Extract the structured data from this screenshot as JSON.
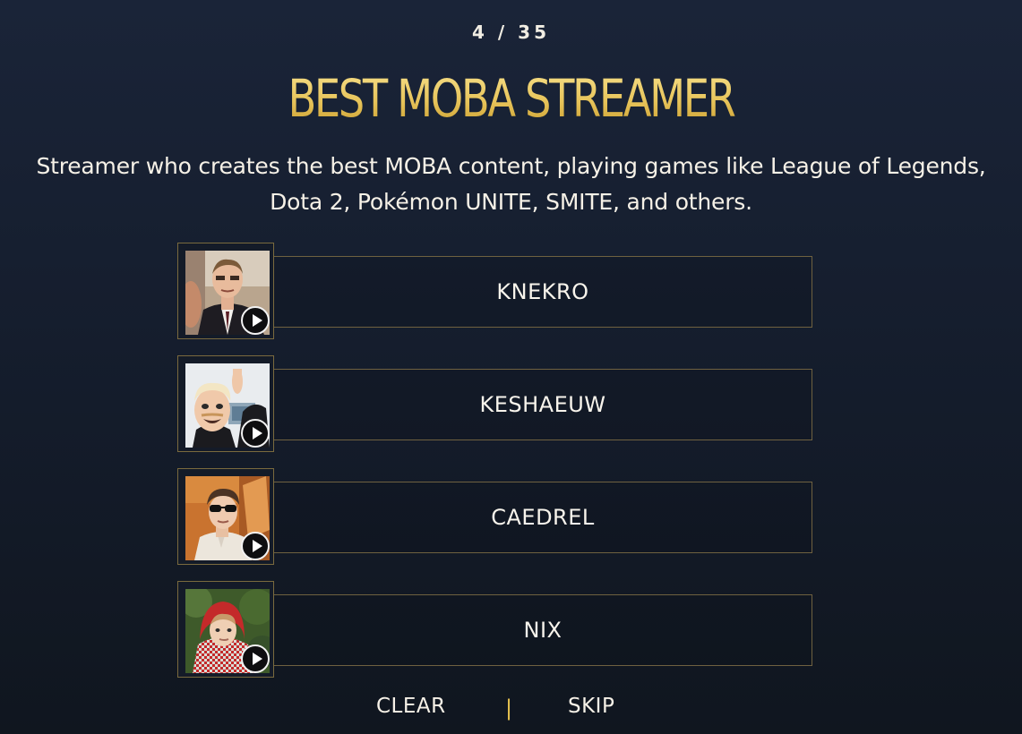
{
  "progress": "4 / 35",
  "category": {
    "title": "BEST MOBA STREAMER",
    "description": "Streamer who creates the best MOBA content, playing games like League of Legends, Dota 2, Pokémon UNITE, SMITE, and others."
  },
  "nominees": [
    {
      "name": "KNEKRO"
    },
    {
      "name": "KESHAEUW"
    },
    {
      "name": "CAEDREL"
    },
    {
      "name": "NIX"
    }
  ],
  "actions": {
    "clear_label": "CLEAR",
    "divider": "|",
    "skip_label": "SKIP"
  },
  "colors": {
    "background": "#172133",
    "gold_accent": "#e6c24f",
    "border": "#6f6140",
    "text": "#f6f1e7"
  },
  "icons": {
    "play": "play-icon"
  }
}
